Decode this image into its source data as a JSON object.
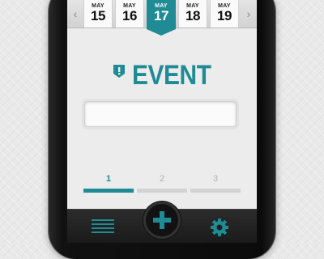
{
  "date_strip": {
    "prev_arrow": "‹",
    "next_arrow": "›",
    "days": [
      {
        "month": "MAY",
        "day": "15"
      },
      {
        "month": "MAY",
        "day": "16"
      },
      {
        "month": "MAY",
        "day": "17"
      },
      {
        "month": "MAY",
        "day": "18"
      },
      {
        "month": "MAY",
        "day": "19"
      }
    ],
    "selected_index": 2
  },
  "title": {
    "text": "EVENT",
    "icon": "alert-tag-icon"
  },
  "event_field": {
    "value": "",
    "placeholder": ""
  },
  "steps": {
    "items": [
      {
        "label": "1"
      },
      {
        "label": "2"
      },
      {
        "label": "3"
      }
    ],
    "active_index": 0
  },
  "tab_bar": {
    "icons": [
      "menu-icon",
      "plus-icon",
      "gear-icon"
    ]
  },
  "colors": {
    "accent": "#1f8c95",
    "bar": "#1a1a1a",
    "background": "#ececec"
  }
}
